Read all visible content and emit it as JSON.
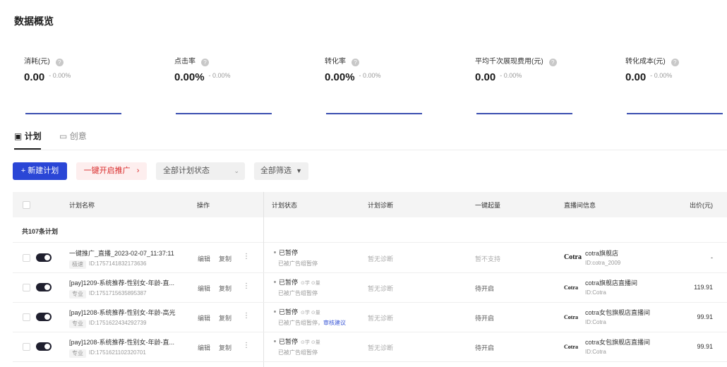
{
  "page": {
    "title": "数据概览"
  },
  "metrics": [
    {
      "label": "消耗(元)",
      "value": "0.00",
      "unit": "",
      "change": "- 0.00%"
    },
    {
      "label": "点击率",
      "value": "0.00",
      "unit": "%",
      "change": "- 0.00%"
    },
    {
      "label": "转化率",
      "value": "0.00",
      "unit": "%",
      "change": "- 0.00%"
    },
    {
      "label": "平均千次展现费用(元)",
      "value": "0.00",
      "unit": "",
      "change": "- 0.00%"
    },
    {
      "label": "转化成本(元)",
      "value": "0.00",
      "unit": "",
      "change": "- 0.00%"
    }
  ],
  "tabs": [
    {
      "label": "计划",
      "icon": "calendar-icon",
      "active": true
    },
    {
      "label": "创意",
      "icon": "card-icon",
      "active": false
    }
  ],
  "toolbar": {
    "new_plan": "+ 新建计划",
    "promote": "一键开启推广",
    "promote_arrow": "›",
    "status_select": "全部计划状态",
    "filter": "全部筛选"
  },
  "table": {
    "headers": {
      "name": "计划名称",
      "op": "操作",
      "status": "计划状态",
      "diag": "计划诊断",
      "boost": "一键起量",
      "room": "直播间信息",
      "bid": "出价(元)"
    },
    "group_label": "共107条计划",
    "op_edit": "编辑",
    "op_copy": "复制",
    "rows": [
      {
        "name": "一键推广_直播_2023-02-07_11:37:11",
        "tag": "极速",
        "id": "ID:1757141832173636",
        "status": "已暂停",
        "status_flags": "",
        "status_sub": "已被广告组暂停",
        "status_link": "",
        "diag": "暂无诊断",
        "boost": "暂不支持",
        "logo": "Cotra",
        "room_name": "cotra旗舰店",
        "room_id": "ID:cotra_2009",
        "bid": "-"
      },
      {
        "name": "[pay]1209-系统推荐-性别女-年龄-直...",
        "tag": "专业",
        "id": "ID:1751715635895387",
        "status": "已暂停",
        "status_flags": "⊙学 ⊙量",
        "status_sub": "已被广告组暂停",
        "status_link": "",
        "diag": "暂无诊断",
        "boost": "待开启",
        "logo": "Cotra",
        "room_name": "cotra旗舰店直播间",
        "room_id": "ID:Cotra",
        "bid": "119.91"
      },
      {
        "name": "[pay]1208-系统推荐-性别女-年龄-高光",
        "tag": "专业",
        "id": "ID:1751622434292739",
        "status": "已暂停",
        "status_flags": "⊙学 ⊙量",
        "status_sub": "已被广告组暂停，",
        "status_link": "审核建议",
        "diag": "暂无诊断",
        "boost": "待开启",
        "logo": "Cotra",
        "room_name": "cotra女包旗舰店直播间",
        "room_id": "ID:Cotra",
        "bid": "99.91"
      },
      {
        "name": "[pay]1208-系统推荐-性别女-年龄-直...",
        "tag": "专业",
        "id": "ID:1751621102320701",
        "status": "已暂停",
        "status_flags": "⊙学 ⊙量",
        "status_sub": "已被广告组暂停",
        "status_link": "",
        "diag": "暂无诊断",
        "boost": "待开启",
        "logo": "Cotra",
        "room_name": "cotra女包旗舰店直播间",
        "room_id": "ID:Cotra",
        "bid": "99.91"
      }
    ]
  },
  "colors": {
    "primary": "#2a46d6",
    "promo_bg": "#fdeeee",
    "promo_text": "#d92a2a",
    "metric_line": "#3b4fb0",
    "link": "#3a57d6"
  }
}
